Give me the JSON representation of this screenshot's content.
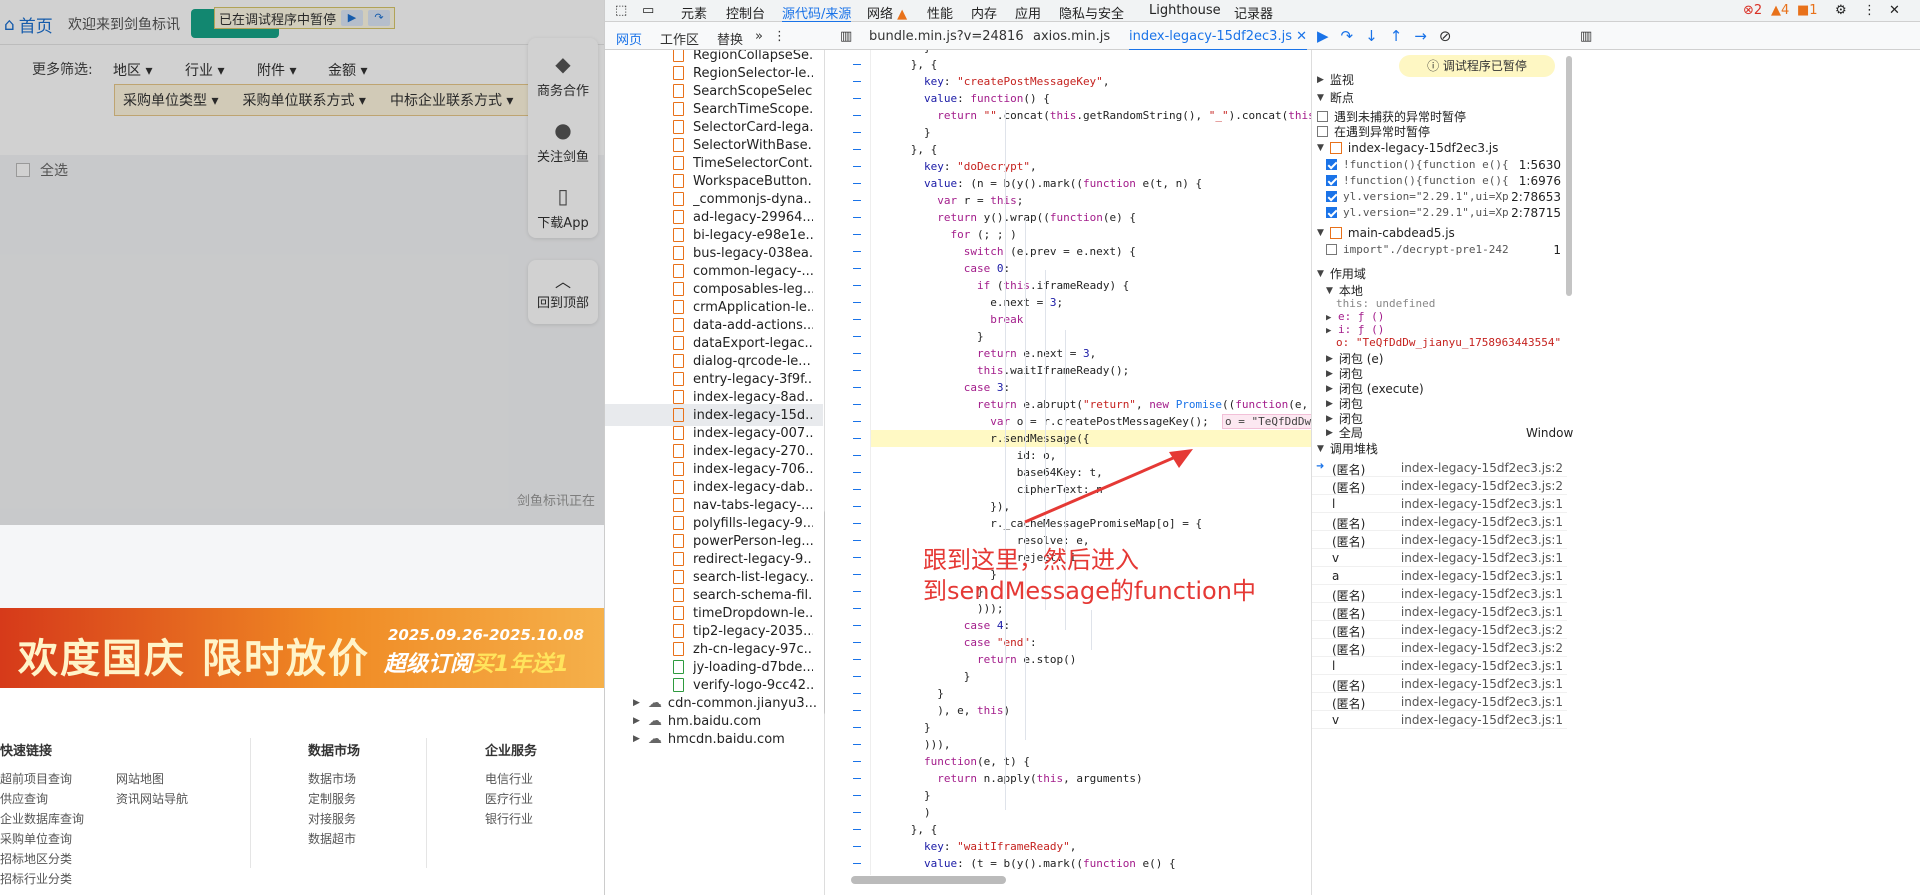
{
  "site": {
    "home_label": "首页",
    "welcome": "欢迎来到剑鱼标讯",
    "paused_label": "已在调试程序中暂停",
    "filter_more": "更多筛选:",
    "filter_region": "地区",
    "filter_industry": "行业",
    "filter_attachment": "附件",
    "filter_amount": "金额",
    "sub_filters": [
      "采购单位类型",
      "采购单位联系方式",
      "中标企业联系方式"
    ],
    "select_all": "全选",
    "side_items": [
      "商务合作",
      "关注剑鱼",
      "下载App"
    ],
    "back_to_top": "回到顶部",
    "loading_text": "剑鱼标讯正在",
    "banner_main": "欢度国庆 限时放价",
    "banner_date": "2025.09.26-2025.10.08",
    "banner_sub_a": "超级订阅",
    "banner_sub_b": "买1年送1",
    "footer": {
      "col1_title": "快速链接",
      "col1_links": [
        "超前项目查询",
        "供应查询",
        "企业数据库查询",
        "采购单位查询",
        "招标地区分类",
        "招标行业分类"
      ],
      "col1b_links": [
        "网站地图",
        "资讯网站导航"
      ],
      "col2_title": "数据市场",
      "col2_links": [
        "数据市场",
        "定制服务",
        "对接服务",
        "数据超市"
      ],
      "col3_title": "企业服务",
      "col3_links": [
        "电信行业",
        "医疗行业",
        "银行行业"
      ]
    }
  },
  "devtools": {
    "main_tabs": [
      "元素",
      "控制台",
      "源代码/来源",
      "网络",
      "性能",
      "内存",
      "应用",
      "隐私与安全",
      "Lighthouse",
      "记录器"
    ],
    "active_tab": "源代码/来源",
    "counts": {
      "errors": "2",
      "warnings": "4",
      "issues": "1"
    },
    "nav_tabs": [
      "网页",
      "工作区",
      "替换"
    ],
    "open_files": [
      "bundle.min.js?v=24816",
      "axios.min.js",
      "index-legacy-15df2ec3.js"
    ],
    "file_tree": [
      "RegionCollapseSe...",
      "RegionSelector-le...",
      "SearchScopeSelec...",
      "SearchTimeScope...",
      "SelectorCard-lega...",
      "SelectorWithBase...",
      "TimeSelectorCont...",
      "WorkspaceButton...",
      "_commonjs-dyna...",
      "ad-legacy-29964...",
      "bi-legacy-e98e1e...",
      "bus-legacy-038ea...",
      "common-legacy-...",
      "composables-leg...",
      "crmApplication-le...",
      "data-add-actions...",
      "dataExport-legac...",
      "dialog-qrcode-le...",
      "entry-legacy-3f9f...",
      "index-legacy-8ad...",
      "index-legacy-15d...",
      "index-legacy-007...",
      "index-legacy-270...",
      "index-legacy-706...",
      "index-legacy-dab...",
      "nav-tabs-legacy-...",
      "polyfills-legacy-9...",
      "powerPerson-leg...",
      "redirect-legacy-9...",
      "search-list-legacy...",
      "search-schema-fil...",
      "timeDropdown-le...",
      "tip2-legacy-2035...",
      "zh-cn-legacy-97c...",
      "jy-loading-d7bde...",
      "verify-logo-9cc42..."
    ],
    "domains": [
      "cdn-common.jianyu3...",
      "hm.baidu.com",
      "hmcdn.baidu.com"
    ],
    "annotation": "跟到这里，然后进入\n到sendMessage的function中",
    "paused_badge": "调试程序已暂停",
    "sections": {
      "watch": "监视",
      "breakpoints": "断点",
      "pause_uncaught": "遇到未捕获的异常时暂停",
      "pause_caught": "在遇到异常时暂停",
      "scope": "作用域",
      "local": "本地",
      "callstack": "调用堆栈"
    },
    "bp_groups": [
      {
        "file": "index-legacy-15df2ec3.js",
        "items": [
          {
            "code": "!function(){function e(){return ...",
            "loc": "1:5630"
          },
          {
            "code": "!function(){function e(){return ...",
            "loc": "1:6976"
          },
          {
            "code": "yl.version=\"2.29.1\",ui=Xp,yl.f...",
            "loc": "2:78653"
          },
          {
            "code": "yl.version=\"2.29.1\",ui=Xp,yl.f...",
            "loc": "2:78715"
          }
        ]
      },
      {
        "file": "main-cabdead5.js",
        "items": [
          {
            "code": "import\"./decrypt-pre1-242b92b6.js\";i...",
            "loc": "1"
          }
        ]
      }
    ],
    "scope_local": {
      "this": "this: undefined",
      "e": "e: ƒ ()",
      "i": "i: ƒ ()",
      "o": "o: \"TeQfDdDw_jianyu_1758963443554\""
    },
    "scope_closures": [
      "闭包 (e)",
      "闭包",
      "闭包 (execute)",
      "闭包",
      "闭包"
    ],
    "scope_global": {
      "label": "全局",
      "value": "Window"
    },
    "callstack": [
      {
        "name": "(匿名)",
        "loc": "index-legacy-15df2ec3.js:2"
      },
      {
        "name": "(匿名)",
        "loc": "index-legacy-15df2ec3.js:2"
      },
      {
        "name": "l",
        "loc": "index-legacy-15df2ec3.js:1"
      },
      {
        "name": "(匿名)",
        "loc": "index-legacy-15df2ec3.js:1"
      },
      {
        "name": "(匿名)",
        "loc": "index-legacy-15df2ec3.js:1"
      },
      {
        "name": "v",
        "loc": "index-legacy-15df2ec3.js:1"
      },
      {
        "name": "a",
        "loc": "index-legacy-15df2ec3.js:1"
      },
      {
        "name": "(匿名)",
        "loc": "index-legacy-15df2ec3.js:1"
      },
      {
        "name": "(匿名)",
        "loc": "index-legacy-15df2ec3.js:1"
      },
      {
        "name": "(匿名)",
        "loc": "index-legacy-15df2ec3.js:2"
      },
      {
        "name": "(匿名)",
        "loc": "index-legacy-15df2ec3.js:2"
      },
      {
        "name": "l",
        "loc": "index-legacy-15df2ec3.js:1"
      },
      {
        "name": "(匿名)",
        "loc": "index-legacy-15df2ec3.js:1"
      },
      {
        "name": "(匿名)",
        "loc": "index-legacy-15df2ec3.js:1"
      },
      {
        "name": "v",
        "loc": "index-legacy-15df2ec3.js:1"
      }
    ]
  }
}
